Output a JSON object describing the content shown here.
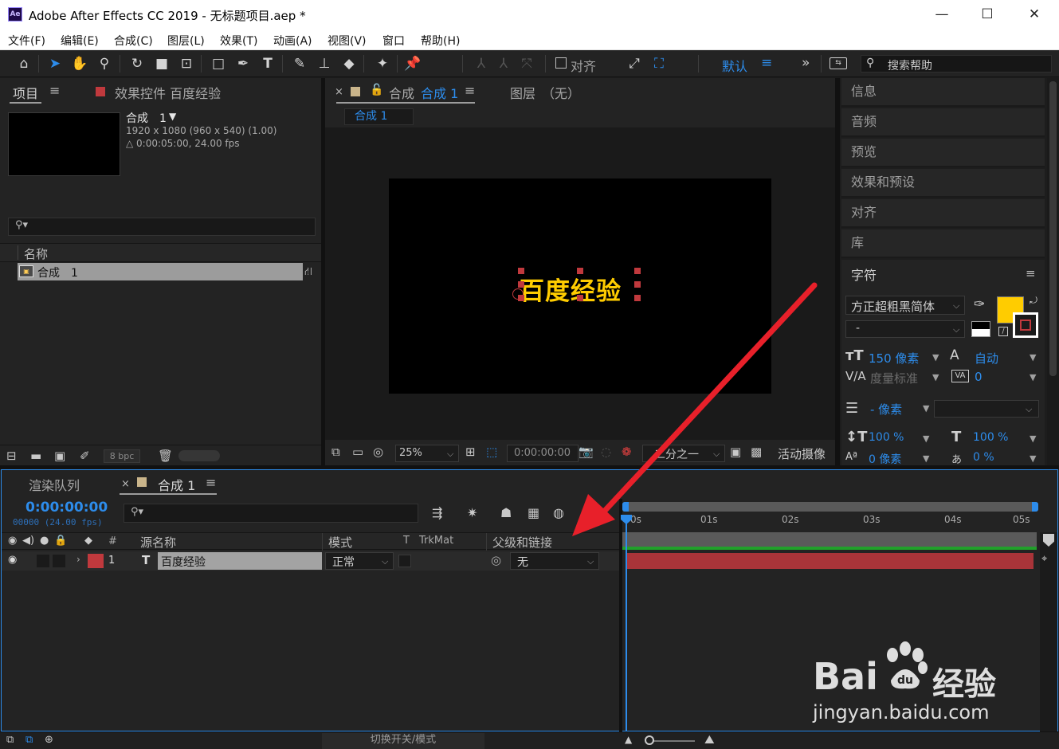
{
  "window": {
    "title": "Adobe After Effects CC 2019 - 无标题项目.aep *",
    "logo": "Ae",
    "minimize": "—",
    "maximize": "☐",
    "close": "✕"
  },
  "menu": [
    "文件(F)",
    "编辑(E)",
    "合成(C)",
    "图层(L)",
    "效果(T)",
    "动画(A)",
    "视图(V)",
    "窗口",
    "帮助(H)"
  ],
  "toolbar": {
    "align_label": "对齐",
    "workspace": "默认",
    "search_placeholder": "搜索帮助"
  },
  "project_panel": {
    "tab_project": "项目",
    "tab_effects": "效果控件 百度经验",
    "comp_name": "合成　1",
    "comp_res": "1920 x 1080  (960 x 540) (1.00)",
    "comp_duration": "△ 0:00:05:00, 24.00 fps",
    "col_name": "名称",
    "item_name": "合成　1",
    "bpc": "8 bpc"
  },
  "comp_panel": {
    "tab_comp_prefix": "合成",
    "tab_comp_name": "合成 1",
    "tab_layer": "图层　（无）",
    "breadcrumb": "合成 1",
    "canvas_text": "百度经验",
    "zoom": "25%",
    "timecode": "0:00:00:00",
    "resolution": "二分之一",
    "camera": "活动摄像"
  },
  "right_panels": [
    "信息",
    "音频",
    "预览",
    "效果和预设",
    "对齐",
    "库"
  ],
  "character": {
    "title": "字符",
    "font": "方正超粗黑简体",
    "style": "-",
    "size": "150 像素",
    "leading": "自动",
    "kerning": "度量标准",
    "tracking": "0",
    "stroke": "- 像素",
    "vscale": "100 %",
    "hscale": "100 %",
    "baseline": "0 像素",
    "tsume": "0 %",
    "fill_color": "#ffcc00"
  },
  "timeline": {
    "tab_render": "渲染队列",
    "tab_comp": "合成 1",
    "timecode": "0:00:00:00",
    "frames": "00000 (24.00 fps)",
    "col_num": "#",
    "col_source": "源名称",
    "col_mode": "模式",
    "col_t": "T",
    "col_trkmat": "TrkMat",
    "col_parent": "父级和链接",
    "layer_index": "1",
    "layer_type": "T",
    "layer_name": "百度经验",
    "layer_mode": "正常",
    "layer_parent": "无",
    "ticks": [
      "0s",
      "01s",
      "02s",
      "03s",
      "04s",
      "05s"
    ],
    "toggle_label": "切换开关/模式",
    "layer_color": "#c0393d"
  },
  "watermark": {
    "brand": "Bai",
    "brand2": "经验",
    "url": "jingyan.baidu.com"
  },
  "colors": {
    "accent": "#2d8ceb",
    "arrow": "#e8202a"
  }
}
